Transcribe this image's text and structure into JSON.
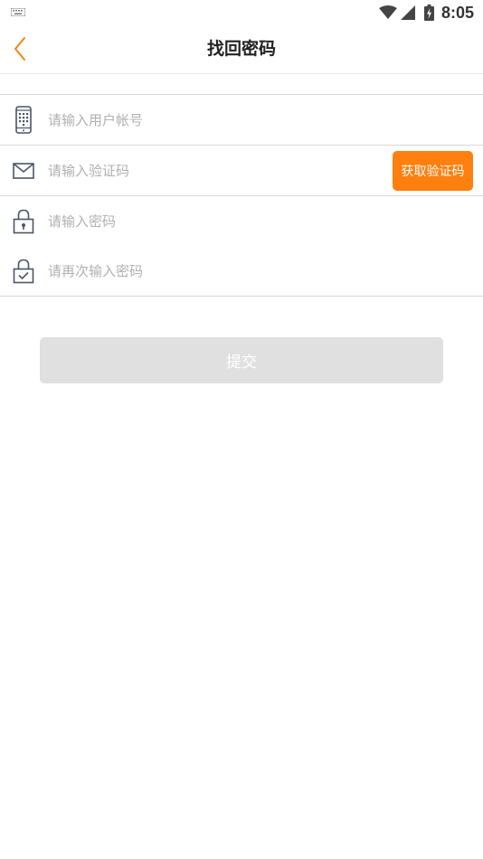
{
  "status_bar": {
    "time": "8:05",
    "icons": [
      "keyboard-icon",
      "wifi-icon",
      "signal-icon",
      "battery-charging-icon"
    ]
  },
  "header": {
    "title": "找回密码",
    "back_icon": "chevron-left-icon"
  },
  "form": {
    "account": {
      "placeholder": "请输入用户帐号",
      "value": "",
      "icon": "phone-icon"
    },
    "code": {
      "placeholder": "请输入验证码",
      "value": "",
      "icon": "mail-icon"
    },
    "get_code_label": "获取验证码",
    "password": {
      "placeholder": "请输入密码",
      "value": "",
      "icon": "lock-icon"
    },
    "confirm_password": {
      "placeholder": "请再次输入密码",
      "value": "",
      "icon": "lock-check-icon"
    }
  },
  "submit_label": "提交",
  "colors": {
    "accent": "#ff7f0f",
    "submit_disabled": "#e0e0e0",
    "icon": "#4a5568",
    "placeholder": "#b0b0b0",
    "divider": "#d8d8d8"
  }
}
